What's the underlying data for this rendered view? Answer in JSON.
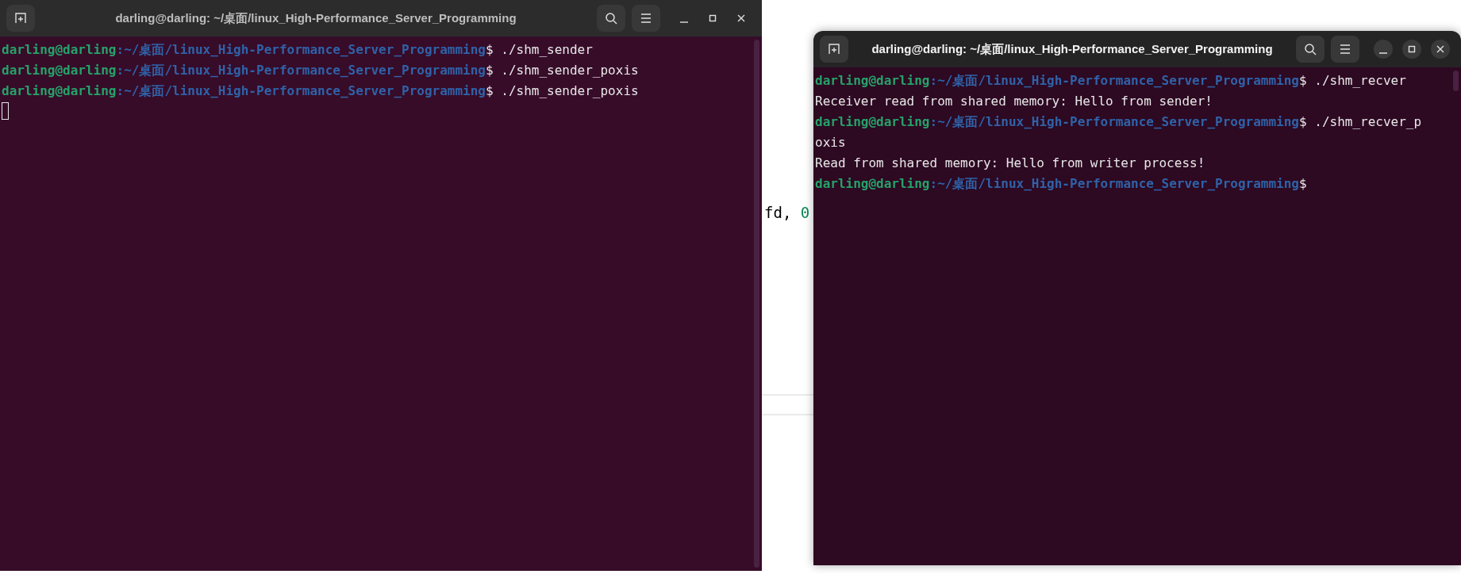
{
  "background_editor": {
    "code_fragment": "fd, 0"
  },
  "windows": [
    {
      "title": "darling@darling: ~/桌面/linux_High-Performance_Server_Programming",
      "focused": false,
      "cursor_visible": true,
      "lines": [
        {
          "user": "darling@darling",
          "path": ":~/桌面/linux_High-Performance_Server_Programming",
          "text": "$ ./shm_sender"
        },
        {
          "user": "darling@darling",
          "path": ":~/桌面/linux_High-Performance_Server_Programming",
          "text": "$ ./shm_sender_poxis"
        },
        {
          "user": "darling@darling",
          "path": ":~/桌面/linux_High-Performance_Server_Programming",
          "text": "$ ./shm_sender_poxis"
        }
      ]
    },
    {
      "title": "darling@darling: ~/桌面/linux_High-Performance_Server_Programming",
      "focused": true,
      "cursor_visible": false,
      "lines": [
        {
          "user": "darling@darling",
          "path": ":~/桌面/linux_High-Performance_Server_Programming",
          "text": "$ ./shm_recver"
        },
        {
          "text": "Receiver read from shared memory: Hello from sender!"
        },
        {
          "user": "darling@darling",
          "path": ":~/桌面/linux_High-Performance_Server_Programming",
          "text": "$ ./shm_recver_p"
        },
        {
          "text": "oxis"
        },
        {
          "text": "Read from shared memory: Hello from writer process!"
        },
        {
          "user": "darling@darling",
          "path": ":~/桌面/linux_High-Performance_Server_Programming",
          "text": "$"
        }
      ]
    }
  ]
}
